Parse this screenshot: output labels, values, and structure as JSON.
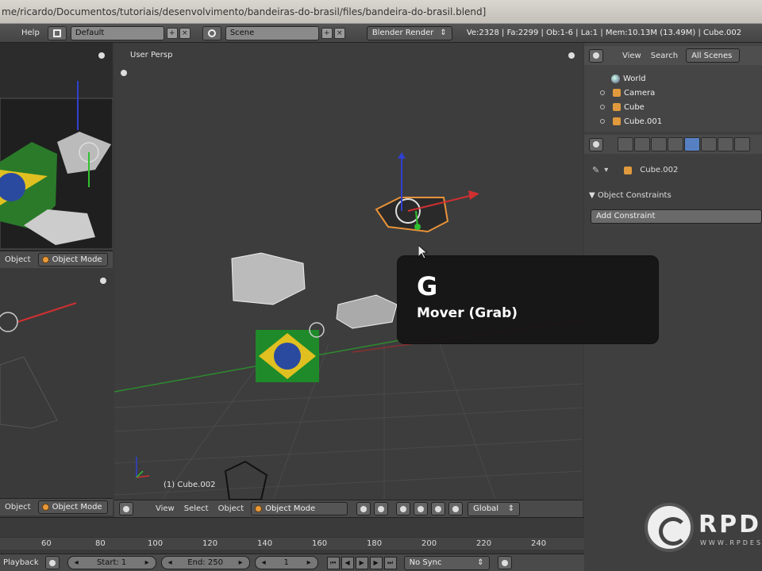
{
  "window": {
    "title_path": "me/ricardo/Documentos/tutoriais/desenvolvimento/bandeiras-do-brasil/files/bandeira-do-brasil.blend]"
  },
  "infobar": {
    "menus": [
      "Help"
    ],
    "layout_name": "Default",
    "scene_name": "Scene",
    "render_engine": "Blender Render",
    "stats": "Ve:2328 | Fa:2299 | Ob:1-6 | La:1 | Mem:10.13M (13.49M) | Cube.002"
  },
  "left_top_viewport": {
    "header_mode_label": "Object",
    "mode": "Object Mode"
  },
  "left_bottom_viewport": {
    "header_mode_label": "Object",
    "mode": "Object Mode"
  },
  "main_viewport": {
    "view_label": "User Persp",
    "object_label": "(1) Cube.002",
    "header": {
      "menus": [
        "View",
        "Select",
        "Object"
      ],
      "mode": "Object Mode",
      "orientation": "Global"
    }
  },
  "outliner": {
    "header": {
      "view": "View",
      "search": "Search",
      "scope": "All Scenes"
    },
    "items": [
      {
        "name": "World",
        "icon": "world-icon"
      },
      {
        "name": "Camera",
        "icon": "camera-icon"
      },
      {
        "name": "Cube",
        "icon": "mesh-icon"
      },
      {
        "name": "Cube.001",
        "icon": "mesh-icon"
      }
    ]
  },
  "properties": {
    "object_name": "Cube.002",
    "panel_title": "Object Constraints",
    "add_button": "Add Constraint"
  },
  "timeline": {
    "ticks": [
      "60",
      "80",
      "100",
      "120",
      "140",
      "160",
      "180",
      "200",
      "220",
      "240"
    ],
    "playback_label": "Playback",
    "start": "Start: 1",
    "end": "End: 250",
    "current": "1",
    "sync": "No Sync"
  },
  "overlay": {
    "key": "G",
    "description": "Mover (Grab)"
  },
  "watermark": {
    "brand": "RPDE",
    "sub": "WWW.RPDES"
  },
  "colors": {
    "active_tab": "#5680c2",
    "object_orange": "#e89a3a",
    "axis_red": "#d03030",
    "axis_green": "#30c030",
    "axis_blue": "#3040d0"
  }
}
